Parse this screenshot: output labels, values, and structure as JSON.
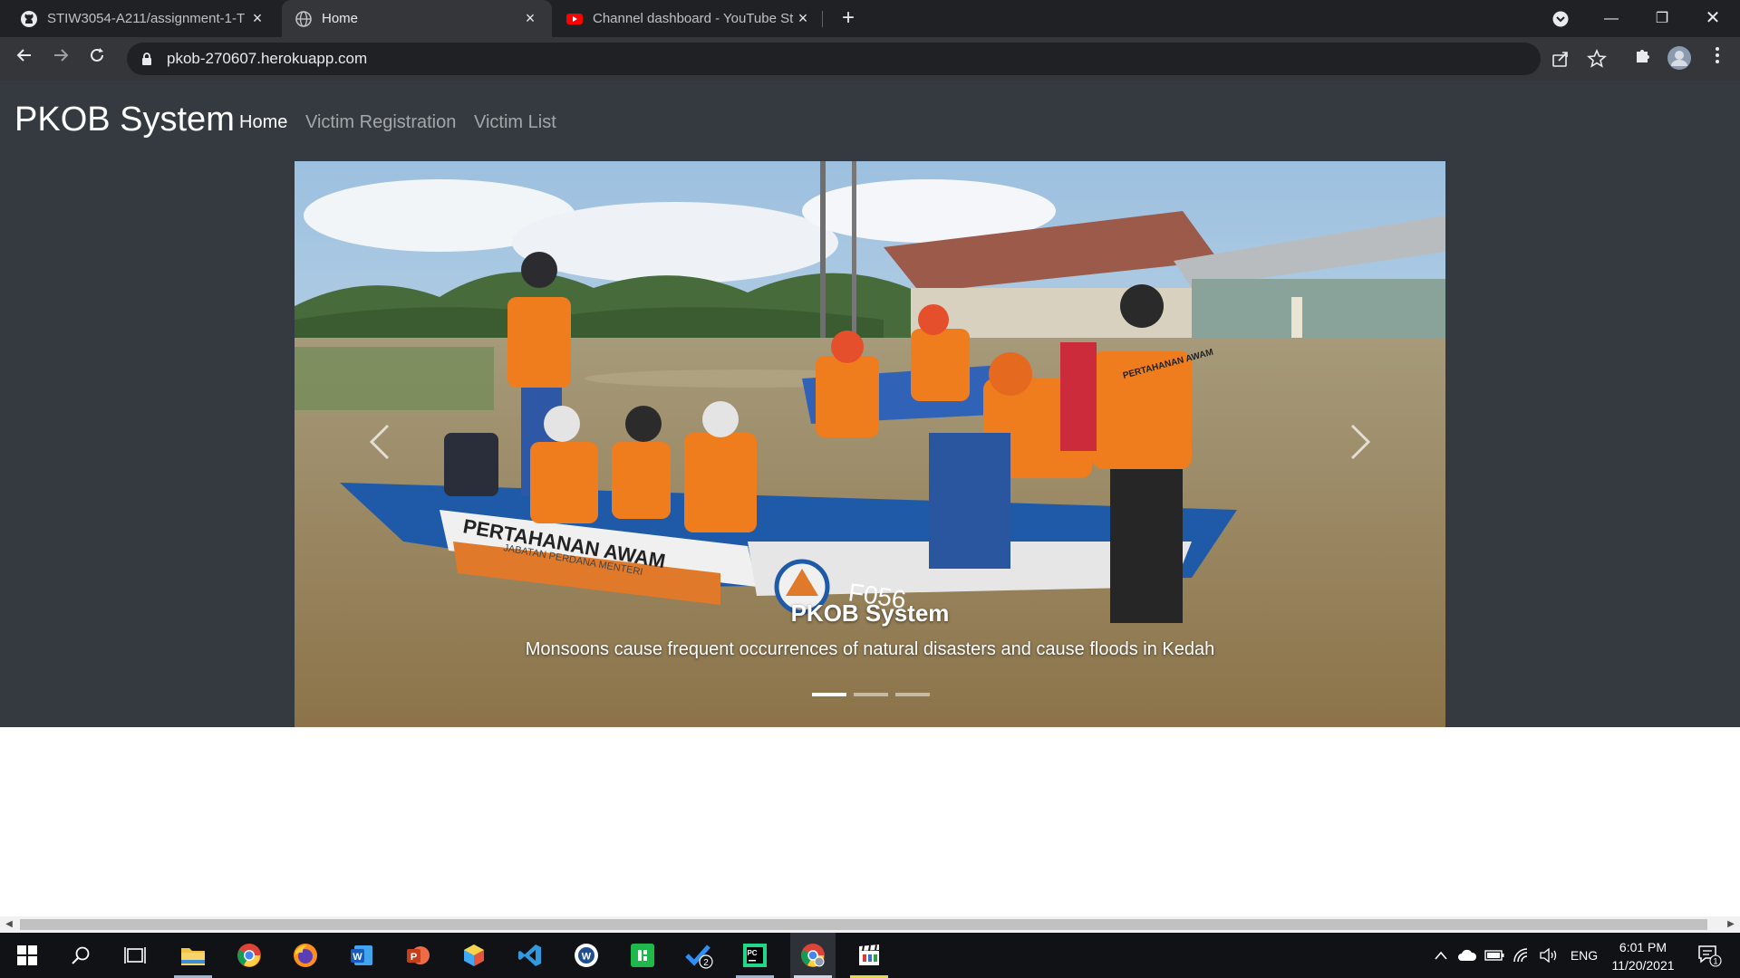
{
  "browser": {
    "tabs": [
      {
        "title": "STIW3054-A211/assignment-1-T",
        "icon": "github-icon"
      },
      {
        "title": "Home",
        "icon": "globe-icon"
      },
      {
        "title": "Channel dashboard - YouTube St",
        "icon": "youtube-icon"
      }
    ],
    "url": "pkob-270607.herokuapp.com"
  },
  "site": {
    "brand": "PKOB System",
    "nav": [
      {
        "label": "Home",
        "active": true
      },
      {
        "label": "Victim Registration",
        "active": false
      },
      {
        "label": "Victim List",
        "active": false
      }
    ]
  },
  "carousel": {
    "slide_count": 3,
    "active_index": 0,
    "caption_title": "PKOB System",
    "caption_text": "Monsoons cause frequent occurrences of natural disasters and cause floods in Kedah",
    "photo_text": {
      "boat_left": "PERTAHANAN AWAM",
      "boat_sub": "JABATAN PERDANA MENTERI",
      "boat_number": "F056",
      "vest": "PERTAHANAN AWAM"
    }
  },
  "taskbar": {
    "apps": [
      "windows-start",
      "search",
      "task-view",
      "file-explorer",
      "chrome",
      "firefox",
      "word",
      "powerpoint",
      "app-cube",
      "vscode",
      "app-w",
      "app-green",
      "todo",
      "pycharm",
      "chrome-profile",
      "clapper"
    ],
    "todo_badge": "2",
    "language": "ENG",
    "time": "6:01 PM",
    "date": "11/20/2021",
    "notification_count": "1"
  },
  "colors": {
    "navbar_bg": "#343a40",
    "chrome_dark": "#202124",
    "chrome_tab_active": "#35363a"
  }
}
